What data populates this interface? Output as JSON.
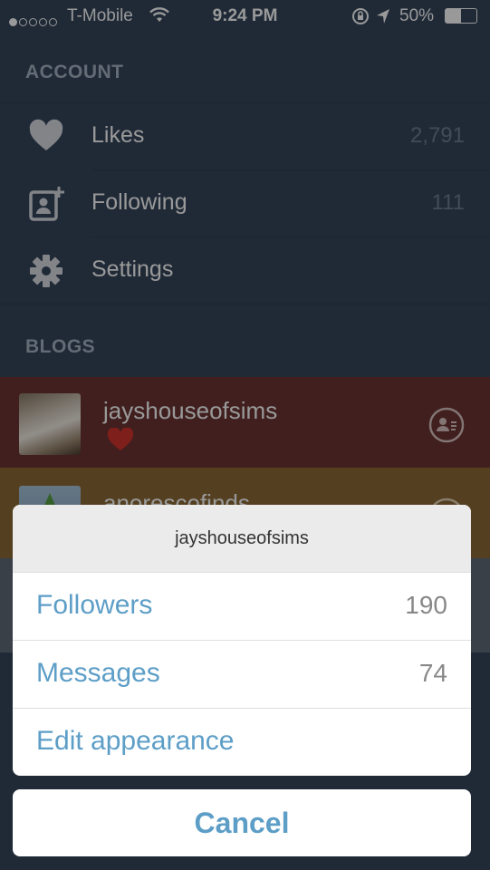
{
  "status_bar": {
    "carrier": "T-Mobile",
    "time": "9:24 PM",
    "battery": "50%"
  },
  "account": {
    "header": "ACCOUNT",
    "items": [
      {
        "label": "Likes",
        "count": "2,791",
        "icon": "heart-icon"
      },
      {
        "label": "Following",
        "count": "111",
        "icon": "add-person-icon"
      },
      {
        "label": "Settings",
        "count": "",
        "icon": "gear-icon"
      }
    ]
  },
  "blogs": {
    "header": "BLOGS",
    "items": [
      {
        "name": "jayshouseofsims",
        "color": "#6b3433"
      },
      {
        "name": "anorescofinds",
        "color": "#8d6a36"
      }
    ]
  },
  "action_sheet": {
    "title": "jayshouseofsims",
    "options": [
      {
        "label": "Followers",
        "count": "190"
      },
      {
        "label": "Messages",
        "count": "74"
      },
      {
        "label": "Edit appearance",
        "count": ""
      }
    ],
    "cancel_label": "Cancel"
  },
  "colors": {
    "background": "#36465d",
    "accent": "#5d9ec7"
  }
}
